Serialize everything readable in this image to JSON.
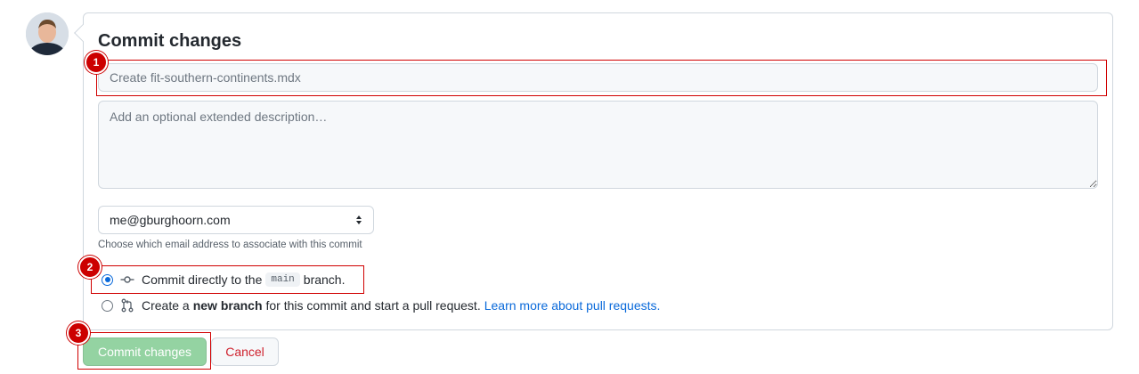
{
  "form": {
    "title": "Commit changes",
    "summary_value": "",
    "summary_placeholder": "Create fit-southern-continents.mdx",
    "description_placeholder": "Add an optional extended description…",
    "email_selected": "me@gburghoorn.com",
    "email_hint": "Choose which email address to associate with this commit",
    "option_direct": {
      "prefix": "Commit directly to the",
      "branch": "main",
      "suffix": "branch.",
      "checked": true
    },
    "option_new_branch": {
      "prefix": "Create a",
      "bold": "new branch",
      "suffix": "for this commit and start a pull request.",
      "link": "Learn more about pull requests.",
      "checked": false
    }
  },
  "buttons": {
    "commit": "Commit changes",
    "cancel": "Cancel"
  },
  "annotations": [
    {
      "label": "1"
    },
    {
      "label": "2"
    },
    {
      "label": "3"
    }
  ],
  "colors": {
    "annotation": "#cc0000",
    "commit_button": "#94d3a2",
    "link": "#0969da",
    "cancel_text": "#cf222e"
  }
}
